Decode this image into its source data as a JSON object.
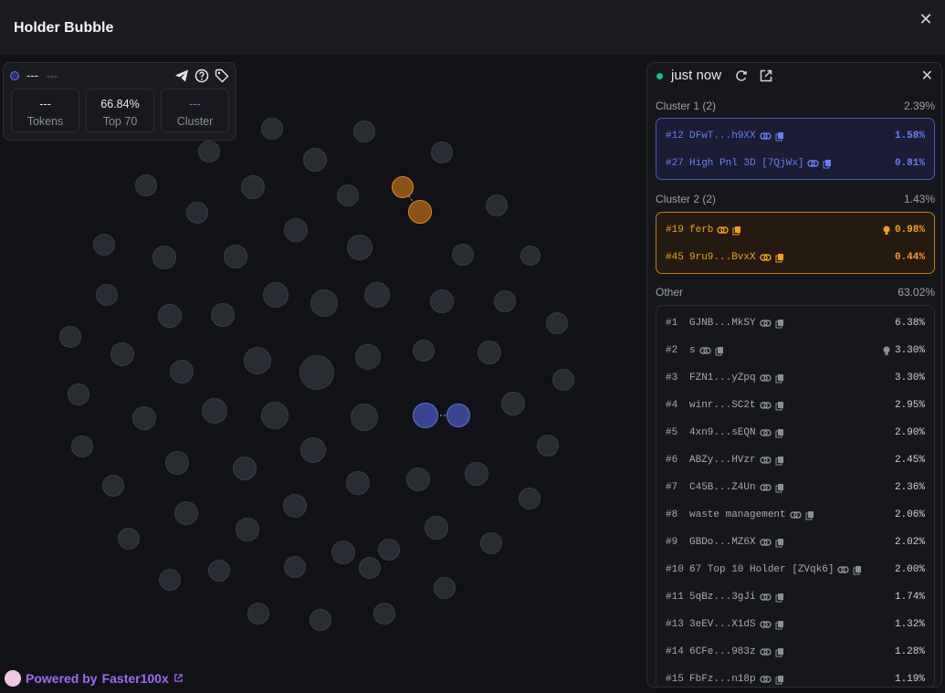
{
  "header": {
    "title": "Holder Bubble",
    "close_label": "✕"
  },
  "token": {
    "name": "---",
    "symbol": "---"
  },
  "stats": [
    {
      "value": "---",
      "label": "Tokens"
    },
    {
      "value": "66.84%",
      "label": "Top 70"
    },
    {
      "value": "---",
      "label": "Cluster"
    }
  ],
  "footer": {
    "powered_prefix": "Powered by",
    "powered_brand": "Faster100x"
  },
  "panel": {
    "updated": "just now",
    "close_label": "✕",
    "cluster1": {
      "title": "Cluster 1 (2)",
      "pct": "2.39%",
      "rows": [
        {
          "rank": "#12",
          "name": "DFwT...h9XX",
          "pct": "1.58%"
        },
        {
          "rank": "#27",
          "name": "High Pnl 3D [7QjWx]",
          "pct": "0.81%"
        }
      ]
    },
    "cluster2": {
      "title": "Cluster 2 (2)",
      "pct": "1.43%",
      "rows": [
        {
          "rank": "#19",
          "name": "ferb",
          "pct": "0.98%"
        },
        {
          "rank": "#45",
          "name": "9ru9...BvxX",
          "pct": "0.44%"
        }
      ]
    },
    "other": {
      "title": "Other",
      "pct": "63.02%",
      "rows": [
        {
          "rank": "#1",
          "name": "GJNB...MkSY",
          "pct": "6.38%"
        },
        {
          "rank": "#2",
          "name": "s",
          "pct": "3.30%"
        },
        {
          "rank": "#3",
          "name": "FZN1...yZpq",
          "pct": "3.30%"
        },
        {
          "rank": "#4",
          "name": "winr...SC2t",
          "pct": "2.95%"
        },
        {
          "rank": "#5",
          "name": "4xn9...sEQN",
          "pct": "2.90%"
        },
        {
          "rank": "#6",
          "name": "ABZy...HVzr",
          "pct": "2.45%"
        },
        {
          "rank": "#7",
          "name": "C45B...Z4Un",
          "pct": "2.36%"
        },
        {
          "rank": "#8",
          "name": "waste management",
          "pct": "2.06%"
        },
        {
          "rank": "#9",
          "name": "GBDo...MZ6X",
          "pct": "2.02%"
        },
        {
          "rank": "#10",
          "name": "67 Top 10 Holder [ZVqk6]",
          "pct": "2.00%"
        },
        {
          "rank": "#11",
          "name": "5qBz...3gJi",
          "pct": "1.74%"
        },
        {
          "rank": "#13",
          "name": "3eEV...X1dS",
          "pct": "1.32%"
        },
        {
          "rank": "#14",
          "name": "6CFe...983z",
          "pct": "1.28%"
        },
        {
          "rank": "#15",
          "name": "FbFz...n18p",
          "pct": "1.19%"
        }
      ]
    }
  },
  "colors": {
    "cluster1": "#6b7ff2",
    "cluster2": "#f39d2c",
    "accent": "#a26bf2",
    "live": "#18c08a"
  }
}
